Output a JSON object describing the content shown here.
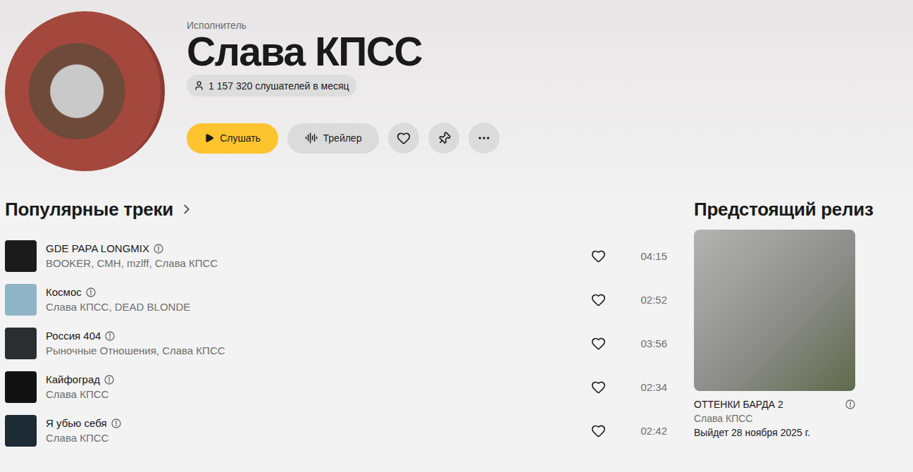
{
  "artist": {
    "label": "Исполнитель",
    "name": "Слава КПСС",
    "listeners": "1 157 320 слушателей в месяц",
    "liked": false
  },
  "actions": {
    "play": "Слушать",
    "trailer": "Трейлер"
  },
  "popular": {
    "title": "Популярные треки",
    "tracks": [
      {
        "title": "GDE PAPA LONGMIX",
        "artists": "BOOKER, CMH, mzlff, Слава КПСС",
        "duration": "04:15",
        "explicit": true,
        "liked": false,
        "color": "#1b1b1b"
      },
      {
        "title": "Космос",
        "artists": "Слава КПСС, DEAD BLONDE",
        "duration": "02:52",
        "explicit": true,
        "liked": false,
        "color": "#8fb4c8"
      },
      {
        "title": "Россия 404",
        "artists": "Рыночные Отношения, Слава КПСС",
        "duration": "03:56",
        "explicit": true,
        "liked": false,
        "color": "#2b2e30"
      },
      {
        "title": "Кайфоград",
        "artists": "Слава КПСС",
        "duration": "02:34",
        "explicit": true,
        "liked": false,
        "color": "#121212"
      },
      {
        "title": "Я убью себя",
        "artists": "Слава КПСС",
        "duration": "02:42",
        "explicit": true,
        "liked": false,
        "color": "#1d2b34"
      }
    ]
  },
  "upcoming": {
    "title": "Предстоящий релиз",
    "release": {
      "title": "ОТТЕНКИ БАРДА 2",
      "artist": "Слава КПСС",
      "date": "Выйдет 28 ноября 2025 г.",
      "explicit": true
    }
  }
}
